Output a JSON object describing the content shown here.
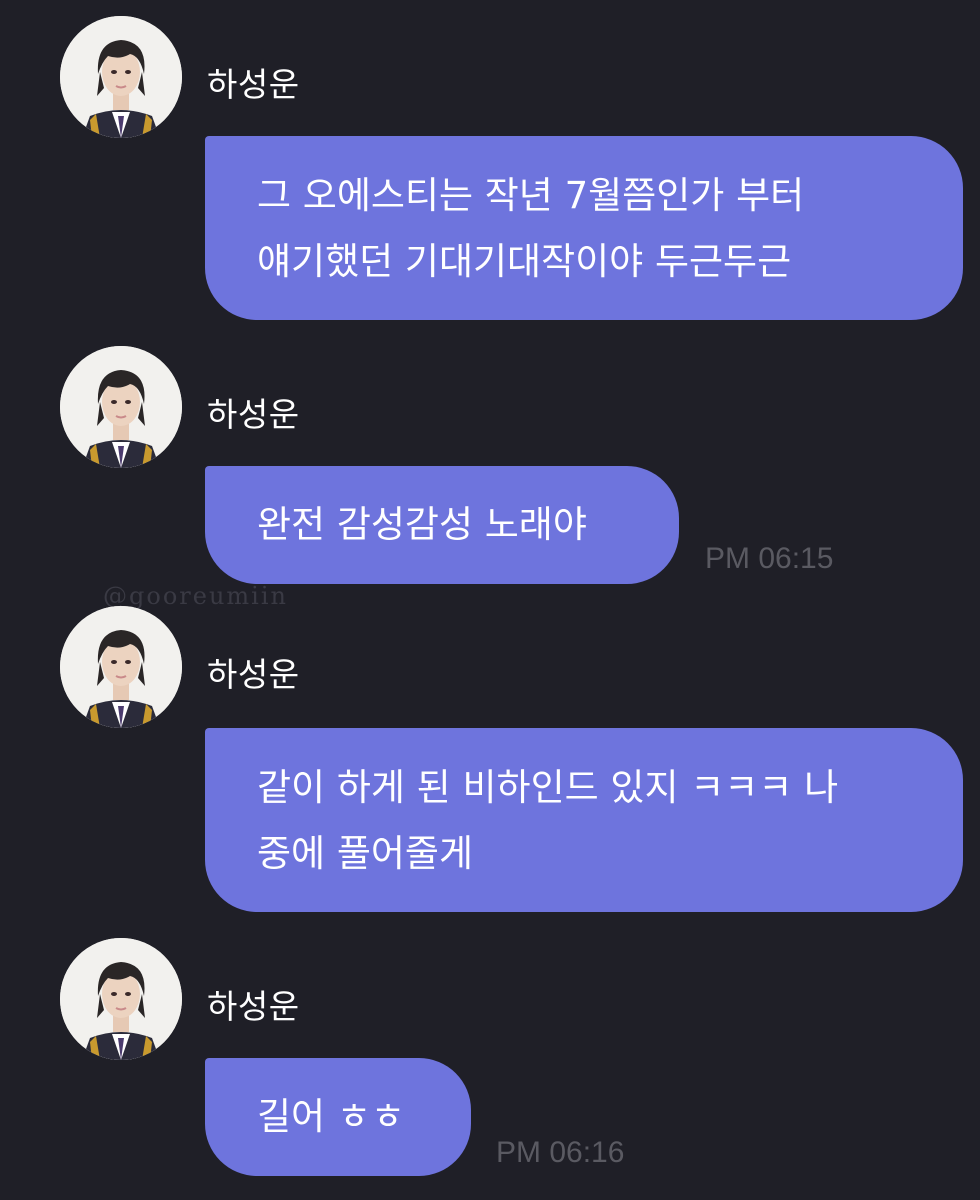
{
  "messages": [
    {
      "sender": "하성운",
      "lines": [
        "그 오에스티는 작년 7월쯤인가 부터",
        "얘기했던 기대기대작이야 두근두근"
      ],
      "time": ""
    },
    {
      "sender": "하성운",
      "lines": [
        "완전 감성감성 노래야"
      ],
      "time": "PM 06:15"
    },
    {
      "sender": "하성운",
      "lines": [
        "같이 하게 된 비하인드 있지 ㅋㅋㅋ 나",
        "중에 풀어줄게"
      ],
      "time": ""
    },
    {
      "sender": "하성운",
      "lines": [
        "길어 ㅎㅎ"
      ],
      "time": "PM 06:16"
    }
  ],
  "watermark": "@gooreumiin",
  "colors": {
    "background": "#1f1f27",
    "bubble": "#6e74dd",
    "timestamp": "#5a5a62"
  },
  "icons": {
    "avatar": "profile-photo"
  }
}
